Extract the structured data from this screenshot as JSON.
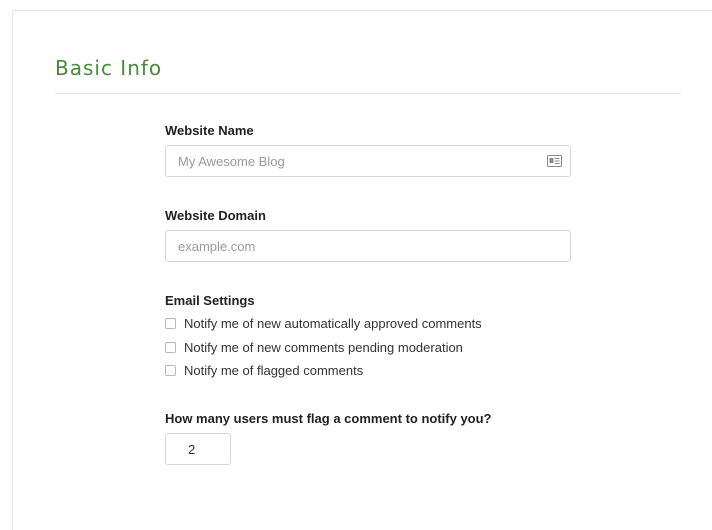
{
  "section": {
    "title": "Basic Info"
  },
  "website_name": {
    "label": "Website Name",
    "placeholder": "My Awesome Blog",
    "icon": "id-card-icon"
  },
  "website_domain": {
    "label": "Website Domain",
    "placeholder": "example.com"
  },
  "email_settings": {
    "label": "Email Settings",
    "options": [
      {
        "label": "Notify me of new automatically approved comments",
        "checked": false
      },
      {
        "label": "Notify me of new comments pending moderation",
        "checked": false
      },
      {
        "label": "Notify me of flagged comments",
        "checked": false
      }
    ]
  },
  "flag_threshold": {
    "label": "How many users must flag a comment to notify you?",
    "value": "2"
  },
  "colors": {
    "accent": "#4a8a3a",
    "border": "#d6d6d6"
  }
}
